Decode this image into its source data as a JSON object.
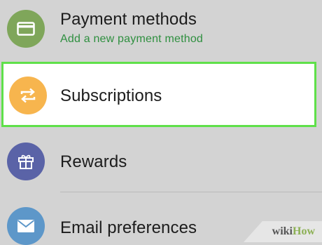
{
  "colors": {
    "background": "#d3d3d3",
    "highlight_border": "#5fe04a",
    "payment_icon_bg": "#7fa65a",
    "subscriptions_icon_bg": "#f7b54e",
    "rewards_icon_bg": "#5a63a7",
    "email_icon_bg": "#5d97c9",
    "subtitle_green": "#2e8f3f"
  },
  "menu": {
    "payment": {
      "icon": "credit-card-icon",
      "title": "Payment methods",
      "subtitle": "Add a new payment method"
    },
    "subscriptions": {
      "icon": "repeat-arrows-icon",
      "title": "Subscriptions"
    },
    "rewards": {
      "icon": "gift-icon",
      "title": "Rewards"
    },
    "email": {
      "icon": "envelope-icon",
      "title": "Email preferences"
    }
  },
  "watermark": {
    "part1": "wiki",
    "part2": "How"
  }
}
